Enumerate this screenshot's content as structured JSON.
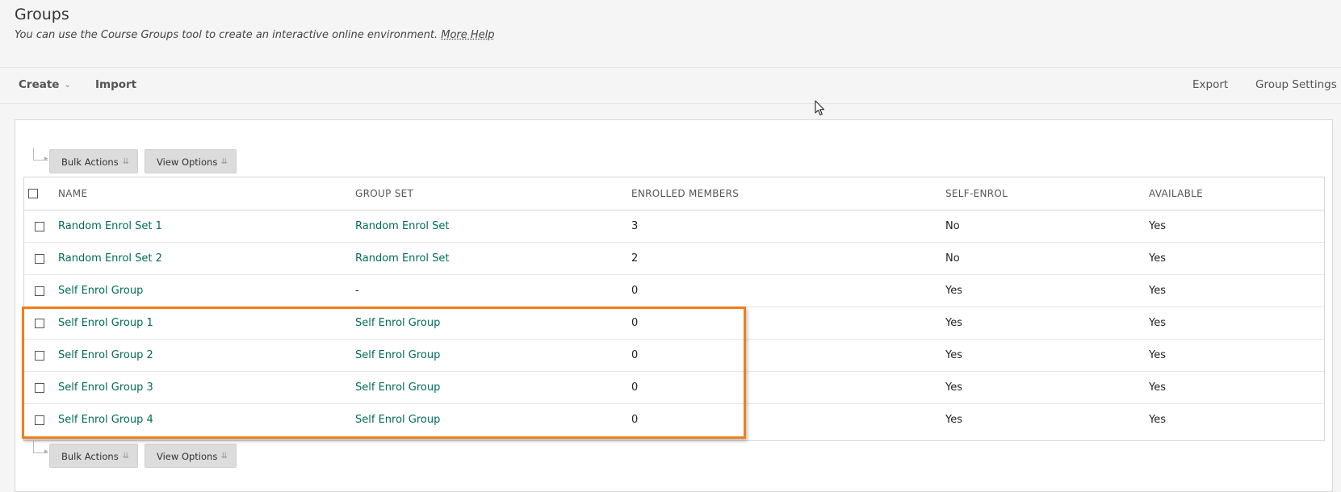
{
  "header": {
    "title": "Groups",
    "description": "You can use the Course Groups tool to create an interactive online environment.",
    "help_link": "More Help"
  },
  "action_bar": {
    "create": "Create",
    "import": "Import",
    "export": "Export",
    "group_settings": "Group Settings"
  },
  "toolbar": {
    "bulk_actions": "Bulk Actions",
    "view_options": "View Options"
  },
  "table": {
    "columns": [
      "NAME",
      "GROUP SET",
      "ENROLLED MEMBERS",
      "SELF-ENROL",
      "AVAILABLE"
    ],
    "rows": [
      {
        "name": "Random Enrol Set 1",
        "group_set": "Random Enrol Set",
        "enrolled": "3",
        "self_enrol": "No",
        "available": "Yes"
      },
      {
        "name": "Random Enrol Set 2",
        "group_set": "Random Enrol Set",
        "enrolled": "2",
        "self_enrol": "No",
        "available": "Yes"
      },
      {
        "name": "Self Enrol Group",
        "group_set": "-",
        "enrolled": "0",
        "self_enrol": "Yes",
        "available": "Yes"
      },
      {
        "name": "Self Enrol Group 1",
        "group_set": "Self Enrol Group",
        "enrolled": "0",
        "self_enrol": "Yes",
        "available": "Yes"
      },
      {
        "name": "Self Enrol Group 2",
        "group_set": "Self Enrol Group",
        "enrolled": "0",
        "self_enrol": "Yes",
        "available": "Yes"
      },
      {
        "name": "Self Enrol Group 3",
        "group_set": "Self Enrol Group",
        "enrolled": "0",
        "self_enrol": "Yes",
        "available": "Yes"
      },
      {
        "name": "Self Enrol Group 4",
        "group_set": "Self Enrol Group",
        "enrolled": "0",
        "self_enrol": "Yes",
        "available": "Yes"
      }
    ]
  },
  "colors": {
    "link": "#006b5a",
    "highlight": "#f07e1b"
  },
  "icons": {
    "create_caret": "chevron-down-icon",
    "menu_caret": "double-chevron-down-icon",
    "connector": "tree-connector-arrow-icon",
    "cursor": "mouse-pointer-icon"
  }
}
